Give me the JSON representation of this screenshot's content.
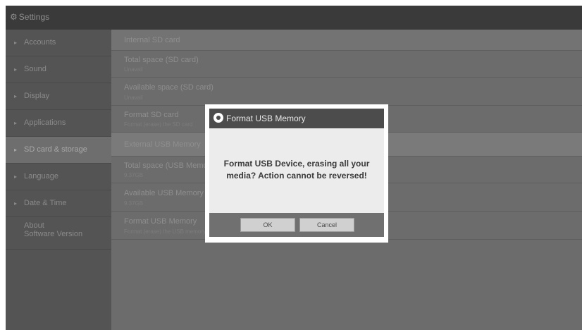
{
  "app": {
    "title": "Settings",
    "icon": "gear-icon"
  },
  "sidebar": {
    "items": [
      {
        "label": "Accounts"
      },
      {
        "label": "Sound"
      },
      {
        "label": "Display"
      },
      {
        "label": "Applications"
      },
      {
        "label": "SD card & storage",
        "active": true
      },
      {
        "label": "Language"
      },
      {
        "label": "Date & Time"
      },
      {
        "label": "About",
        "sublabel": "Software Version"
      }
    ]
  },
  "main": {
    "rows": [
      {
        "title": "Internal SD card"
      },
      {
        "title": "Total space (SD card)",
        "subtitle": "Unavail"
      },
      {
        "title": "Available space (SD card)",
        "subtitle": "Unavail"
      },
      {
        "title": "Format SD card",
        "subtitle": "Format (erase) the SD card"
      },
      {
        "title": "External USB Memory"
      },
      {
        "title": "Total space (USB Memory)",
        "subtitle": "9.37GB"
      },
      {
        "title": "Available USB Memory",
        "subtitle": "9.37GB"
      },
      {
        "title": "Format USB Memory",
        "subtitle": "Format (erase) the USB memory"
      }
    ]
  },
  "dialog": {
    "title": "Format USB Memory",
    "icon": "settings-icon",
    "message": "Format USB Device, erasing all your media? Action cannot be reversed!",
    "ok_label": "OK",
    "cancel_label": "Cancel"
  }
}
